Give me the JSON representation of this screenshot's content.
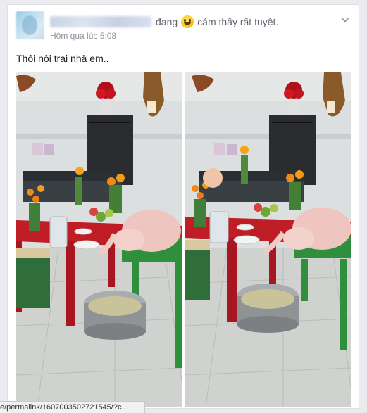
{
  "post": {
    "feeling_prefix": "đang",
    "feeling_text": "cảm thấy rất tuyệt.",
    "timestamp": "Hôm qua lúc 5:08",
    "text": "Thôi nôi trai nhà em..",
    "menu_icon": "chevron-down-icon"
  },
  "photos": [
    {
      "name": "offering-table-photo-left"
    },
    {
      "name": "offering-table-photo-right"
    }
  ],
  "status_bar": {
    "url": "e/permalink/1607003502721545/?c..."
  },
  "colors": {
    "background": "#e9ebee",
    "card": "#ffffff",
    "meta_text": "#90949c",
    "body_text": "#1d2129"
  }
}
